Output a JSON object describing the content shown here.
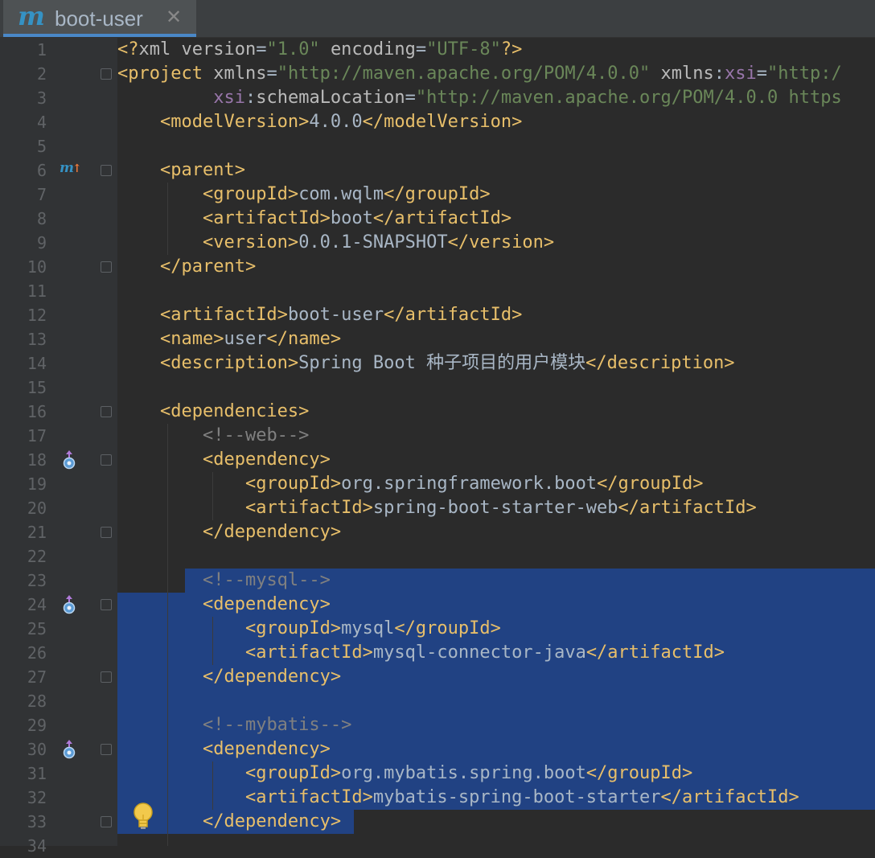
{
  "tab": {
    "icon": "maven-m-icon",
    "title": "boot-user",
    "close": "✕"
  },
  "colors": {
    "tag": "#e8bf6a",
    "attr": "#bababa",
    "value": "#6a8759",
    "namespace": "#9876aa",
    "comment": "#808080",
    "selection": "#214283"
  },
  "lines": [
    {
      "n": "1",
      "tokens": [
        [
          "t",
          "<?"
        ],
        [
          "a",
          "xml version"
        ],
        [
          "",
          "="
        ],
        [
          "v",
          "\"1.0\""
        ],
        [
          "",
          " "
        ],
        [
          "a",
          "encoding"
        ],
        [
          "",
          "="
        ],
        [
          "v",
          "\"UTF-8\""
        ],
        [
          "t",
          "?>"
        ]
      ]
    },
    {
      "n": "2",
      "tokens": [
        [
          "t",
          "<project "
        ],
        [
          "a",
          "xmlns"
        ],
        [
          "",
          "="
        ],
        [
          "v",
          "\"http://maven.apache.org/POM/4.0.0\""
        ],
        [
          "",
          " "
        ],
        [
          "a",
          "xmlns"
        ],
        [
          "",
          ":"
        ],
        [
          "ns",
          "xsi"
        ],
        [
          "",
          "="
        ],
        [
          "v",
          "\"http:/"
        ]
      ]
    },
    {
      "n": "3",
      "tokens": [
        [
          "",
          "         "
        ],
        [
          "ns",
          "xsi"
        ],
        [
          "",
          ":"
        ],
        [
          "a",
          "schemaLocation"
        ],
        [
          "",
          "="
        ],
        [
          "v",
          "\"http://maven.apache.org/POM/4.0.0 https"
        ]
      ]
    },
    {
      "n": "4",
      "tokens": [
        [
          "",
          "    "
        ],
        [
          "t",
          "<modelVersion>"
        ],
        [
          "",
          "4.0.0"
        ],
        [
          "t",
          "</modelVersion>"
        ]
      ]
    },
    {
      "n": "5",
      "tokens": []
    },
    {
      "n": "6",
      "tokens": [
        [
          "",
          "    "
        ],
        [
          "t",
          "<parent>"
        ]
      ]
    },
    {
      "n": "7",
      "tokens": [
        [
          "",
          "        "
        ],
        [
          "t",
          "<groupId>"
        ],
        [
          "",
          "com.wqlm"
        ],
        [
          "t",
          "</groupId>"
        ]
      ]
    },
    {
      "n": "8",
      "tokens": [
        [
          "",
          "        "
        ],
        [
          "t",
          "<artifactId>"
        ],
        [
          "",
          "boot"
        ],
        [
          "t",
          "</artifactId>"
        ]
      ]
    },
    {
      "n": "9",
      "tokens": [
        [
          "",
          "        "
        ],
        [
          "t",
          "<version>"
        ],
        [
          "",
          "0.0.1-SNAPSHOT"
        ],
        [
          "t",
          "</version>"
        ]
      ]
    },
    {
      "n": "10",
      "tokens": [
        [
          "",
          "    "
        ],
        [
          "t",
          "</parent>"
        ]
      ]
    },
    {
      "n": "11",
      "tokens": []
    },
    {
      "n": "12",
      "tokens": [
        [
          "",
          "    "
        ],
        [
          "t",
          "<artifactId>"
        ],
        [
          "",
          "boot-user"
        ],
        [
          "t",
          "</artifactId>"
        ]
      ]
    },
    {
      "n": "13",
      "tokens": [
        [
          "",
          "    "
        ],
        [
          "t",
          "<name>"
        ],
        [
          "",
          "user"
        ],
        [
          "t",
          "</name>"
        ]
      ]
    },
    {
      "n": "14",
      "tokens": [
        [
          "",
          "    "
        ],
        [
          "t",
          "<description>"
        ],
        [
          "",
          "Spring Boot 种子项目的用户模块"
        ],
        [
          "t",
          "</description>"
        ]
      ]
    },
    {
      "n": "15",
      "tokens": []
    },
    {
      "n": "16",
      "tokens": [
        [
          "",
          "    "
        ],
        [
          "t",
          "<dependencies>"
        ]
      ]
    },
    {
      "n": "17",
      "tokens": [
        [
          "",
          "        "
        ],
        [
          "c",
          "<!--web-->"
        ]
      ]
    },
    {
      "n": "18",
      "tokens": [
        [
          "",
          "        "
        ],
        [
          "t",
          "<dependency>"
        ]
      ]
    },
    {
      "n": "19",
      "tokens": [
        [
          "",
          "            "
        ],
        [
          "t",
          "<groupId>"
        ],
        [
          "",
          "org.springframework.boot"
        ],
        [
          "t",
          "</groupId>"
        ]
      ]
    },
    {
      "n": "20",
      "tokens": [
        [
          "",
          "            "
        ],
        [
          "t",
          "<artifactId>"
        ],
        [
          "",
          "spring-boot-starter-web"
        ],
        [
          "t",
          "</artifactId>"
        ]
      ]
    },
    {
      "n": "21",
      "tokens": [
        [
          "",
          "        "
        ],
        [
          "t",
          "</dependency>"
        ]
      ]
    },
    {
      "n": "22",
      "tokens": []
    },
    {
      "n": "23",
      "tokens": [
        [
          "",
          "        "
        ],
        [
          "c",
          "<!--mysql-->"
        ]
      ]
    },
    {
      "n": "24",
      "tokens": [
        [
          "",
          "        "
        ],
        [
          "t",
          "<dependency>"
        ]
      ]
    },
    {
      "n": "25",
      "tokens": [
        [
          "",
          "            "
        ],
        [
          "t",
          "<groupId>"
        ],
        [
          "",
          "mysql"
        ],
        [
          "t",
          "</groupId>"
        ]
      ]
    },
    {
      "n": "26",
      "tokens": [
        [
          "",
          "            "
        ],
        [
          "t",
          "<artifactId>"
        ],
        [
          "",
          "mysql-connector-java"
        ],
        [
          "t",
          "</artifactId>"
        ]
      ]
    },
    {
      "n": "27",
      "tokens": [
        [
          "",
          "        "
        ],
        [
          "t",
          "</dependency>"
        ]
      ]
    },
    {
      "n": "28",
      "tokens": []
    },
    {
      "n": "29",
      "tokens": [
        [
          "",
          "        "
        ],
        [
          "c",
          "<!--mybatis-->"
        ]
      ]
    },
    {
      "n": "30",
      "tokens": [
        [
          "",
          "        "
        ],
        [
          "t",
          "<dependency>"
        ]
      ]
    },
    {
      "n": "31",
      "tokens": [
        [
          "",
          "            "
        ],
        [
          "t",
          "<groupId>"
        ],
        [
          "",
          "org.mybatis.spring.boot"
        ],
        [
          "t",
          "</groupId>"
        ]
      ]
    },
    {
      "n": "32",
      "tokens": [
        [
          "",
          "            "
        ],
        [
          "t",
          "<artifactId>"
        ],
        [
          "",
          "mybatis-spring-boot-starter"
        ],
        [
          "t",
          "</artifactId>"
        ]
      ]
    },
    {
      "n": "33",
      "tokens": [
        [
          "",
          "        "
        ],
        [
          "t",
          "</dependency>"
        ]
      ]
    },
    {
      "n": "34",
      "tokens": []
    }
  ],
  "gutter_icons": [
    {
      "line": 6,
      "icon": "maven-parent-override-icon",
      "label": "m",
      "arrow": "↑"
    },
    {
      "line": 18,
      "icon": "dependency-icon"
    },
    {
      "line": 24,
      "icon": "dependency-icon"
    },
    {
      "line": 30,
      "icon": "dependency-icon"
    }
  ],
  "fold_markers": [
    2,
    6,
    10,
    16,
    18,
    21,
    24,
    27,
    30,
    33
  ],
  "intention_bulb": "lightbulb-icon"
}
